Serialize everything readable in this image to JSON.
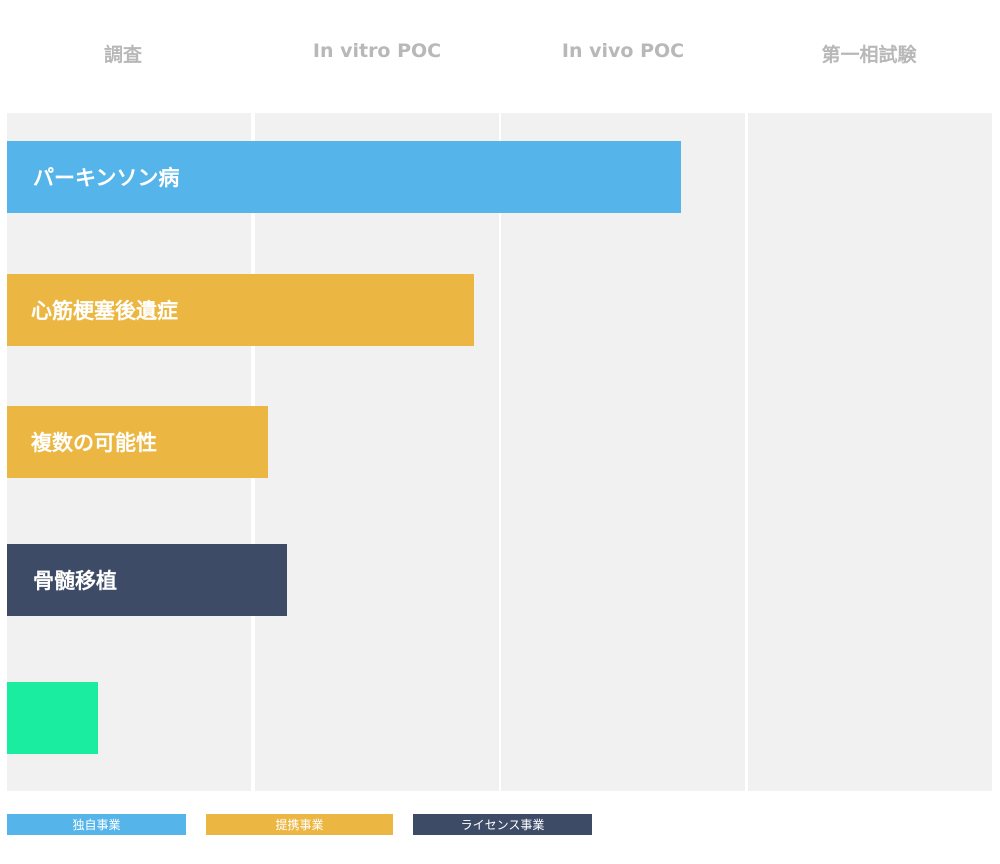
{
  "chart_data": {
    "type": "bar",
    "orientation": "horizontal",
    "stages": [
      "調査",
      "In vitro POC",
      "In vivo POC",
      "第一相試験"
    ],
    "categories": [
      "パーキンソン病",
      "心筋梗塞後遺症",
      "複数の可能性",
      "骨髄移植",
      ""
    ],
    "values": [
      2.74,
      1.9,
      1.06,
      1.14,
      0.37
    ],
    "bar_types": [
      "独自事業",
      "提携事業",
      "提携事業",
      "ライセンス事業",
      ""
    ],
    "xlim": [
      0,
      4
    ],
    "legend": [
      {
        "label": "独自事業",
        "color": "#55b4e9"
      },
      {
        "label": "提携事業",
        "color": "#ebb742"
      },
      {
        "label": "ライセンス事業",
        "color": "#3d4b67"
      }
    ],
    "extra_bar_color": "#1aeca0",
    "legend_position": "bottom"
  }
}
